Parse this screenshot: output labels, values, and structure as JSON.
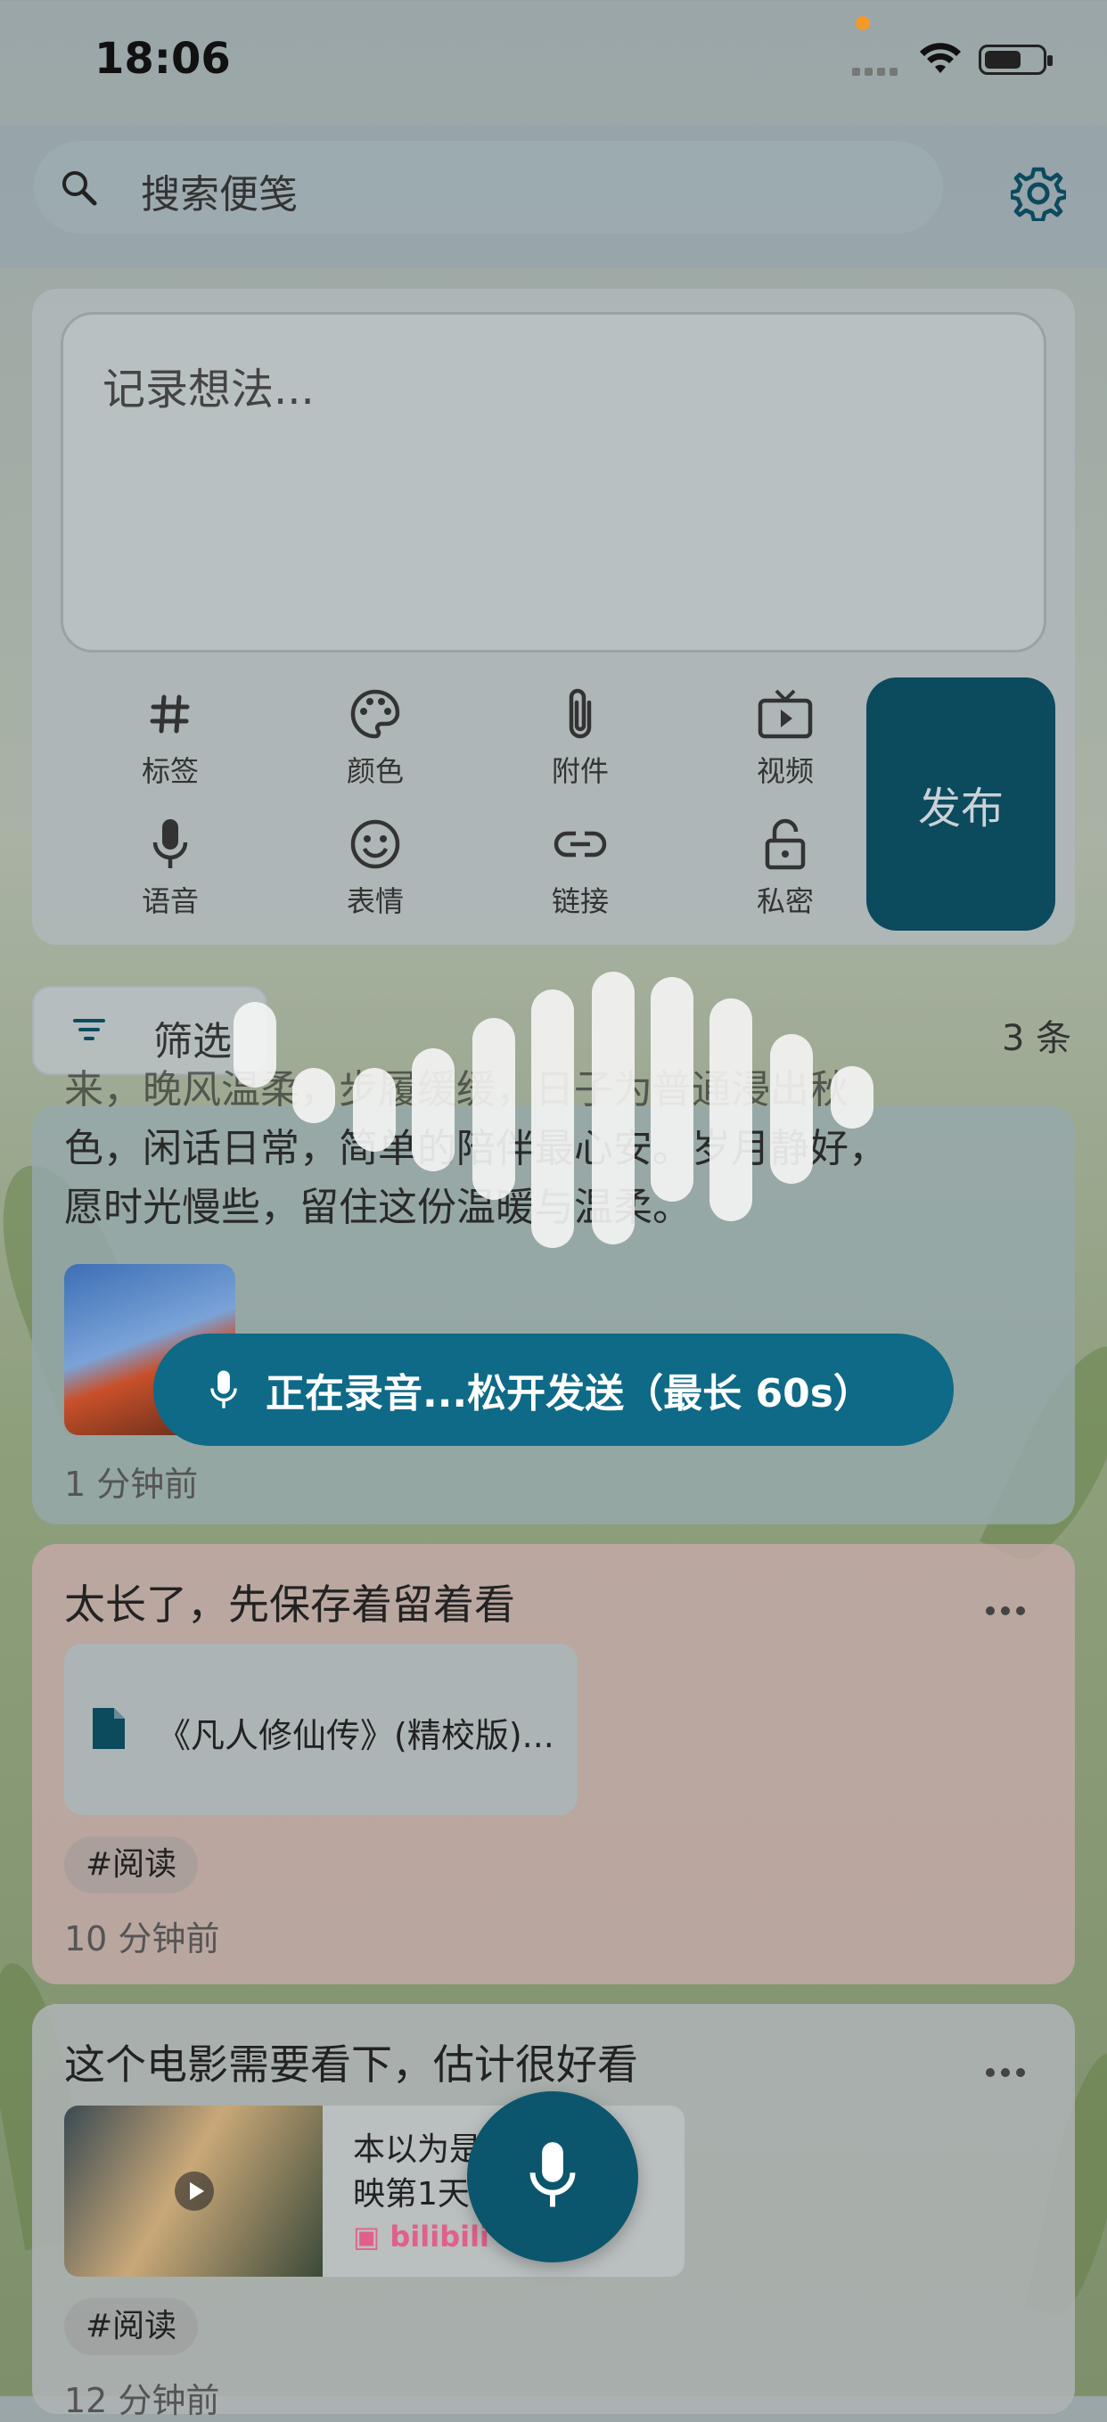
{
  "status_bar": {
    "time": "18:06"
  },
  "search": {
    "placeholder": "搜索便笺"
  },
  "composer": {
    "placeholder": "记录想法...",
    "tools": [
      {
        "label": "标签",
        "icon": "hashtag-icon"
      },
      {
        "label": "颜色",
        "icon": "palette-icon"
      },
      {
        "label": "附件",
        "icon": "paperclip-icon"
      },
      {
        "label": "视频",
        "icon": "video-icon"
      },
      {
        "label": "语音",
        "icon": "microphone-icon"
      },
      {
        "label": "表情",
        "icon": "smile-icon"
      },
      {
        "label": "链接",
        "icon": "link-icon"
      },
      {
        "label": "私密",
        "icon": "lock-icon"
      }
    ],
    "publish_label": "发布"
  },
  "filter": {
    "label": "筛选",
    "count": "3 条"
  },
  "notes": [
    {
      "text_line0": "来，晚风温柔，步履缓缓，日子为普通浸出秋",
      "text_line1": "色，闲话日常，简单的陪伴最心安。岁月静好，",
      "text_line2": "愿时光慢些，留住这份温暖与温柔。",
      "time": "1 分钟前"
    },
    {
      "title": "太长了，先保存着留着看",
      "file_name": "《凡人修仙传》(精校版)...",
      "tag": "#阅读",
      "time": "10 分钟前"
    },
    {
      "title": "这个电影需要看下，估计很好看",
      "link_line1": "本以为是",
      "link_line2": "映第1天",
      "link_source": "bilibili",
      "tag": "#阅读",
      "time": "12 分钟前"
    }
  ],
  "recording": {
    "message": "正在录音...松开发送（最长 60s）"
  },
  "colors": {
    "primary": "#0c4a5e",
    "recording_pill": "#0e6a86",
    "accent_orange": "#f39a2b",
    "bilibili_pink": "#e0608a"
  }
}
